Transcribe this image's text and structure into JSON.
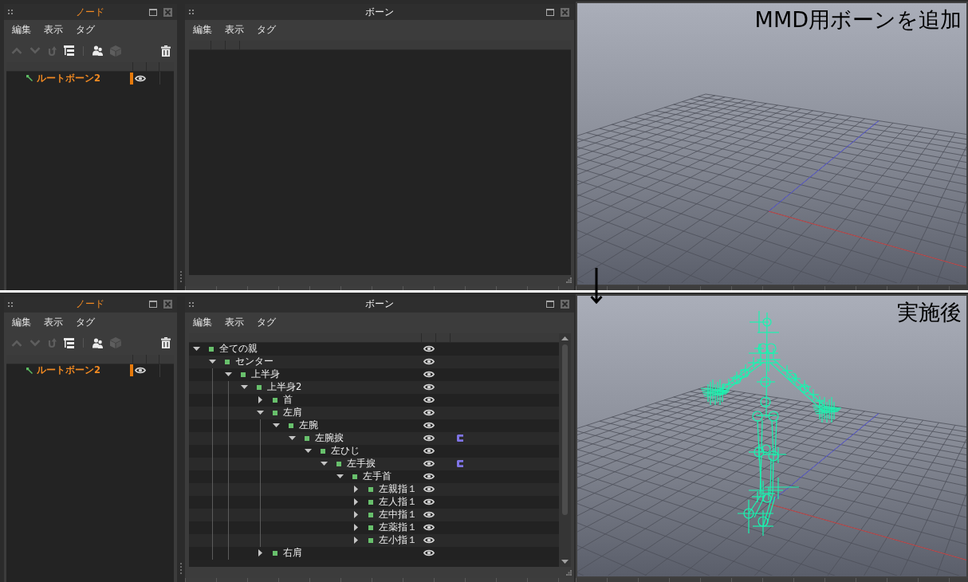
{
  "screens": [
    {
      "node_panel": {
        "title": "ノード",
        "active": true,
        "menu": [
          "編集",
          "表示",
          "タグ"
        ],
        "tools": [
          {
            "kind": "move-up",
            "disabled": true
          },
          {
            "kind": "move-down",
            "disabled": true
          },
          {
            "kind": "rotate",
            "disabled": true
          },
          {
            "kind": "hierarchy",
            "disabled": false
          },
          {
            "kind": "separator"
          },
          {
            "kind": "people",
            "disabled": false
          },
          {
            "kind": "cube",
            "disabled": true
          }
        ],
        "end_tools": [
          {
            "kind": "delete",
            "disabled": false
          }
        ],
        "nodes": [
          {
            "label": "ルートボーン2",
            "selected": true,
            "visible": true
          }
        ]
      },
      "bone_panel": {
        "title": "ボーン",
        "active": false,
        "menu": [
          "編集",
          "表示",
          "タグ"
        ]
      },
      "viewport": {
        "caption": "MMD用ボーンを追加",
        "bones_shown": false
      }
    },
    {
      "node_panel": {
        "title": "ノード",
        "active": true,
        "menu": [
          "編集",
          "表示",
          "タグ"
        ],
        "tools": [
          {
            "kind": "move-up",
            "disabled": true
          },
          {
            "kind": "move-down",
            "disabled": true
          },
          {
            "kind": "rotate",
            "disabled": true
          },
          {
            "kind": "hierarchy",
            "disabled": false
          },
          {
            "kind": "separator"
          },
          {
            "kind": "people",
            "disabled": false
          },
          {
            "kind": "cube",
            "disabled": true
          }
        ],
        "end_tools": [
          {
            "kind": "delete",
            "disabled": false
          }
        ],
        "nodes": [
          {
            "label": "ルートボーン2",
            "selected": true,
            "visible": true
          }
        ]
      },
      "bone_panel": {
        "title": "ボーン",
        "active": false,
        "menu": [
          "編集",
          "表示",
          "タグ"
        ],
        "bones": [
          {
            "name": "全ての親",
            "expanded": true,
            "visible": true,
            "bracket_icon": false,
            "children": [
              {
                "name": "センター",
                "expanded": true,
                "visible": true,
                "bracket_icon": false,
                "guide_line": true,
                "children": [
                  {
                    "name": "上半身",
                    "expanded": true,
                    "visible": true,
                    "bracket_icon": false,
                    "guide_line": true,
                    "children": [
                      {
                        "name": "上半身2",
                        "expanded": true,
                        "visible": true,
                        "bracket_icon": false,
                        "children": [
                          {
                            "name": "首",
                            "expanded": false,
                            "visible": true,
                            "bracket_icon": false
                          },
                          {
                            "name": "左肩",
                            "expanded": true,
                            "visible": true,
                            "bracket_icon": false,
                            "guide_line": true,
                            "children": [
                              {
                                "name": "左腕",
                                "expanded": true,
                                "visible": true,
                                "bracket_icon": false,
                                "children": [
                                  {
                                    "name": "左腕捩",
                                    "expanded": true,
                                    "visible": true,
                                    "bracket_icon": true,
                                    "children": [
                                      {
                                        "name": "左ひじ",
                                        "expanded": true,
                                        "visible": true,
                                        "bracket_icon": false,
                                        "children": [
                                          {
                                            "name": "左手捩",
                                            "expanded": true,
                                            "visible": true,
                                            "bracket_icon": true,
                                            "children": [
                                              {
                                                "name": "左手首",
                                                "expanded": true,
                                                "visible": true,
                                                "bracket_icon": false,
                                                "children": [
                                                  {
                                                    "name": "左親指１",
                                                    "expanded": false,
                                                    "visible": true,
                                                    "bracket_icon": false
                                                  },
                                                  {
                                                    "name": "左人指１",
                                                    "expanded": false,
                                                    "visible": true,
                                                    "bracket_icon": false
                                                  },
                                                  {
                                                    "name": "左中指１",
                                                    "expanded": false,
                                                    "visible": true,
                                                    "bracket_icon": false
                                                  },
                                                  {
                                                    "name": "左薬指１",
                                                    "expanded": false,
                                                    "visible": true,
                                                    "bracket_icon": false
                                                  },
                                                  {
                                                    "name": "左小指１",
                                                    "expanded": false,
                                                    "visible": true,
                                                    "bracket_icon": false
                                                  }
                                                ]
                                              }
                                            ]
                                          }
                                        ]
                                      }
                                    ]
                                  }
                                ]
                              }
                            ]
                          },
                          {
                            "name": "右肩",
                            "expanded": false,
                            "visible": true,
                            "bracket_icon": false
                          }
                        ]
                      }
                    ]
                  }
                ]
              }
            ]
          }
        ]
      },
      "viewport": {
        "caption": "実施後",
        "bones_shown": true
      }
    }
  ]
}
